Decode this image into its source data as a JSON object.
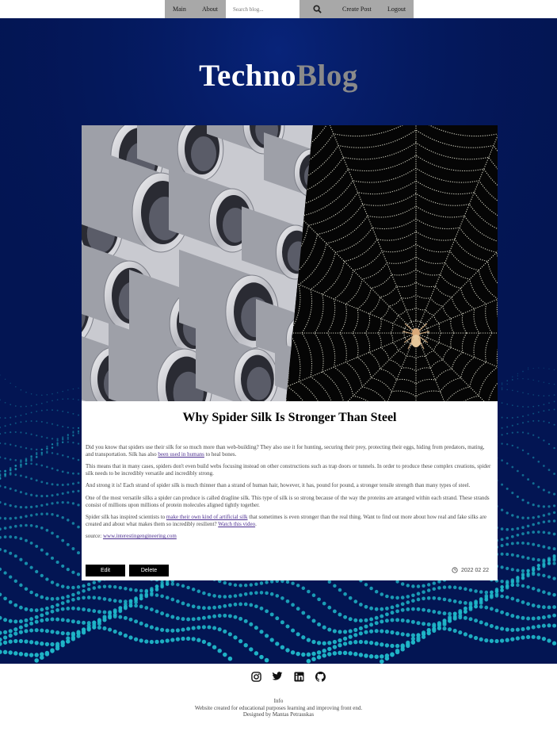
{
  "nav": {
    "main": "Main",
    "about": "About",
    "search_placeholder": "Search blog...",
    "search_icon": "search-icon",
    "create": "Create Post",
    "logout": "Logout"
  },
  "logo": {
    "part1": "Techno",
    "part2": "Blog"
  },
  "post": {
    "title": "Why Spider Silk Is Stronger Than Steel",
    "p1_a": "Did you know that spiders use their silk for so much more than web-building? They also use it for hunting, securing their prey, protecting their eggs, hiding from predators, mating, and transportation. Silk has also ",
    "p1_link": "been used in humans",
    "p1_b": " to heal bones.",
    "p2": "This means that in many cases, spiders don't even build webs focusing instead on other constructions such as trap doors or tunnels. In order to produce these complex creations, spider silk needs to be incredibly versatile and incredibly strong.",
    "p3": "And strong it is! Each strand of spider silk is much thinner than a strand of human hair, however, it has, pound for pound, a stronger tensile strength than many types of steel.",
    "p4": "One of the most versatile silks a spider can produce is called dragline silk. This type of silk is so strong because of the way the proteins are arranged within each strand. These strands consist of millions upon millions of protein molecules aligned tightly together.",
    "p5_a": "Spider silk has inspired scientists to ",
    "p5_link1": "make their own kind of artificial silk",
    "p5_b": " that sometimes is even stronger than the real thing. Want to find out more about how real and fake silks are created and about what makes them so incredibly resilient? ",
    "p5_link2": "Watch this video",
    "p5_c": ".",
    "source_label": "source: ",
    "source_link": "www.interestingengineering.com",
    "edit": "Edit",
    "delete": "Delete",
    "date": "2022 02 22",
    "date_icon": "clock-icon"
  },
  "footer": {
    "socials": [
      "instagram-icon",
      "twitter-icon",
      "linkedin-icon",
      "github-icon"
    ],
    "line1": "Info",
    "line2": "Website created for educational purposes learning and improving front end.",
    "line3": "Designed by Mantas Petrauskas"
  },
  "colors": {
    "hero_bg": "#031553",
    "dots": "#1fb6c8",
    "nav_bg": "#a8a8a8"
  }
}
